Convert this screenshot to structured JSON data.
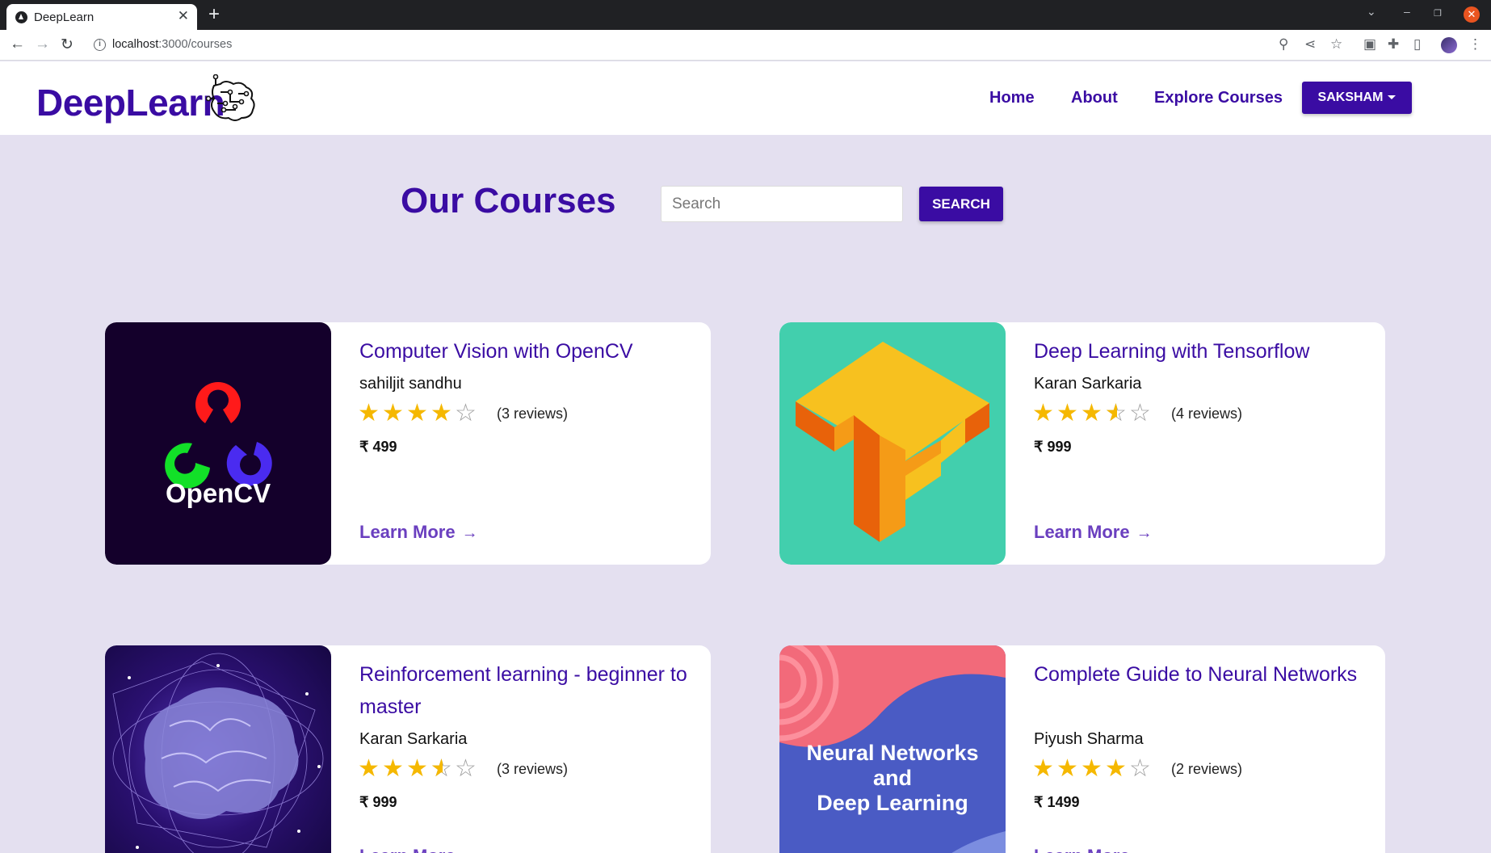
{
  "browser": {
    "tab_title": "DeepLearn",
    "url_host": "localhost",
    "url_path": ":3000/courses"
  },
  "header": {
    "brand": "DeepLearn",
    "nav": [
      "Home",
      "About",
      "Explore Courses"
    ],
    "user_button": "SAKSHAM"
  },
  "main": {
    "title": "Our Courses",
    "search_placeholder": "Search",
    "search_button": "SEARCH"
  },
  "courses": [
    {
      "title": "Computer Vision with OpenCV",
      "author": "sahiljit sandhu",
      "rating": 4,
      "reviews": "(3 reviews)",
      "price": "₹ 499",
      "cta": "Learn More",
      "image_label": "OpenCV"
    },
    {
      "title": "Deep Learning with Tensorflow",
      "author": "Karan Sarkaria",
      "rating": 3.5,
      "reviews": "(4 reviews)",
      "price": "₹ 999",
      "cta": "Learn More",
      "image_label": ""
    },
    {
      "title": "Reinforcement learning - beginner to master",
      "author": "Karan Sarkaria",
      "rating": 3.5,
      "reviews": "(3 reviews)",
      "price": "₹ 999",
      "cta": "Learn More",
      "image_label": ""
    },
    {
      "title": "Complete Guide to Neural Networks",
      "author": "Piyush Sharma",
      "rating": 4,
      "reviews": "(2 reviews)",
      "price": "₹ 1499",
      "cta": "Learn More",
      "image_label_lines": [
        "Neural Networks",
        "and",
        "Deep Learning"
      ]
    }
  ],
  "colors": {
    "primary": "#3a0ca3",
    "page_background": "#e4e0f0",
    "star": "#f5b800",
    "link": "#6a3fbf"
  }
}
